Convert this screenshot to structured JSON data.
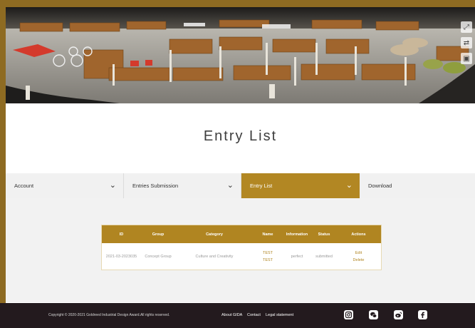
{
  "page": {
    "title": "Entry List"
  },
  "nav": {
    "items": [
      {
        "label": "Account"
      },
      {
        "label": "Entries Submission"
      },
      {
        "label": "Entry List"
      },
      {
        "label": "Download"
      }
    ]
  },
  "table": {
    "headers": {
      "id": "ID",
      "group": "Group",
      "category": "Category",
      "name": "Name",
      "information": "Information",
      "status": "Status",
      "actions": "Actions"
    },
    "rows": [
      {
        "id": "2021-03-2023035",
        "group": "Concept Group",
        "category": "Culture and Creativity",
        "name_line1": "TEST",
        "name_line2": "TEST",
        "information": "perfect",
        "status": "submitted",
        "action_edit": "Edit",
        "action_delete": "Delete"
      }
    ]
  },
  "footer": {
    "copyright": "Copyright © 2020-2021 Goldreed Industrial Design Award.All rights reserved.",
    "links": [
      "About GIDA",
      "Contact",
      "Legal statement"
    ],
    "social_icons": [
      "instagram-icon",
      "wechat-icon",
      "weibo-icon",
      "facebook-icon"
    ]
  },
  "colors": {
    "accent": "#b08521",
    "frame": "#8e6b22",
    "footer_bg": "#231a1e"
  }
}
